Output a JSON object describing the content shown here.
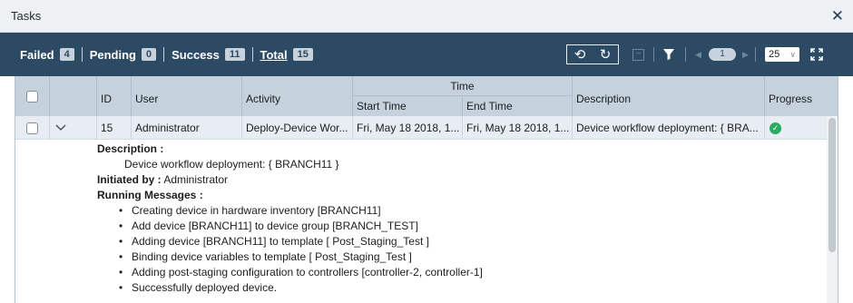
{
  "window": {
    "title": "Tasks",
    "close_icon": "close-icon"
  },
  "summary": {
    "failed_label": "Failed",
    "failed_count": "4",
    "pending_label": "Pending",
    "pending_count": "0",
    "success_label": "Success",
    "success_count": "11",
    "total_label": "Total",
    "total_count": "15"
  },
  "toolbar": {
    "refresh_icons": [
      "refresh-auto-icon",
      "refresh-icon"
    ],
    "page_number": "1",
    "page_size": "25",
    "icons": [
      "minus-box-icon",
      "filter-icon",
      "prev-page-icon",
      "next-page-icon",
      "expand-icon"
    ]
  },
  "table": {
    "columns": {
      "id": "ID",
      "user": "User",
      "activity": "Activity",
      "time": "Time",
      "start_time": "Start Time",
      "end_time": "End Time",
      "description": "Description",
      "progress": "Progress"
    },
    "rows": [
      {
        "id": "15",
        "user": "Administrator",
        "activity": "Deploy-Device Wor...",
        "start_time": "Fri, May 18 2018, 1...",
        "end_time": "Fri, May 18 2018, 1...",
        "description": "Device workflow deployment: { BRA...",
        "progress_status": "success"
      }
    ]
  },
  "detail": {
    "description_label": "Description :",
    "description_value": "Device workflow deployment: { BRANCH11 }",
    "initiated_label": "Initiated by :",
    "initiated_value": "Administrator",
    "messages_label": "Running Messages :",
    "messages": [
      "Creating device in hardware inventory [BRANCH11]",
      "Add device [BRANCH11] to device group [BRANCH_TEST]",
      "Adding device [BRANCH11] to template [ Post_Staging_Test ]",
      "Binding device variables to template [ Post_Staging_Test ]",
      "Adding post-staging configuration to controllers [controller-2, controller-1]",
      "Successfully deployed device."
    ]
  },
  "colors": {
    "toolbar_bg": "#2c4a63",
    "header_bg": "#c5d2dd",
    "row_bg": "#e7edf2",
    "success": "#2bab61"
  }
}
